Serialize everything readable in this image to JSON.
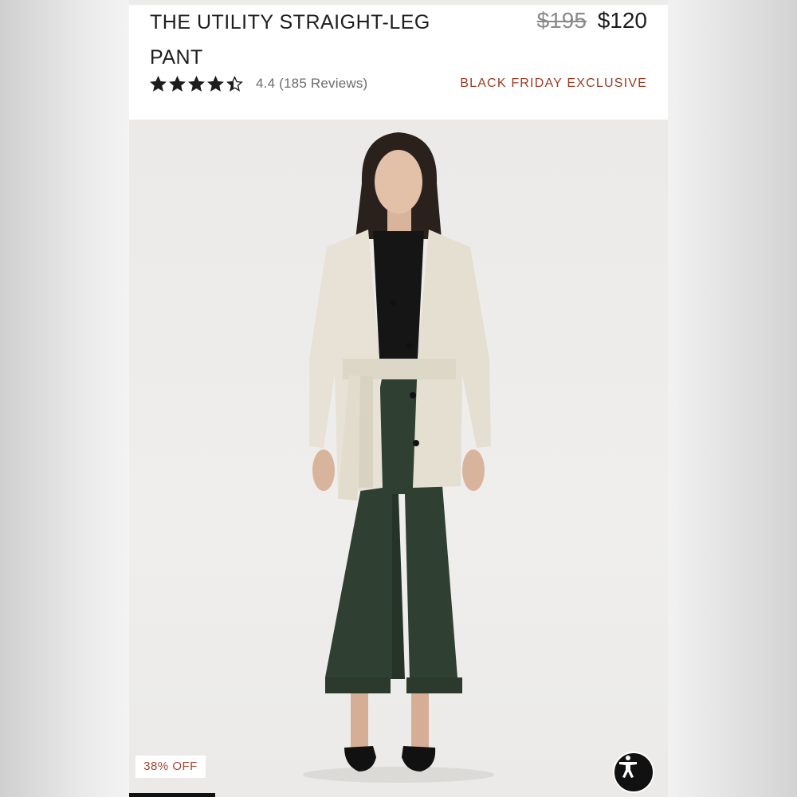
{
  "product": {
    "title": "THE UTILITY STRAIGHT-LEG PANT",
    "original_price": "$195",
    "sale_price": "$120",
    "rating_value": 4.4,
    "rating_text": "4.4 (185 Reviews)",
    "promo_label": "BLACK FRIDAY EXCLUSIVE",
    "discount_badge": "38% OFF"
  },
  "colors": {
    "promo": "#9a3a24",
    "pant_green": "#2f3f31",
    "jacket_cream": "#e7e2d5"
  },
  "icons": {
    "star": "star-icon",
    "accessibility": "accessibility-icon"
  },
  "gallery": {
    "progress_fraction": 0.16
  }
}
